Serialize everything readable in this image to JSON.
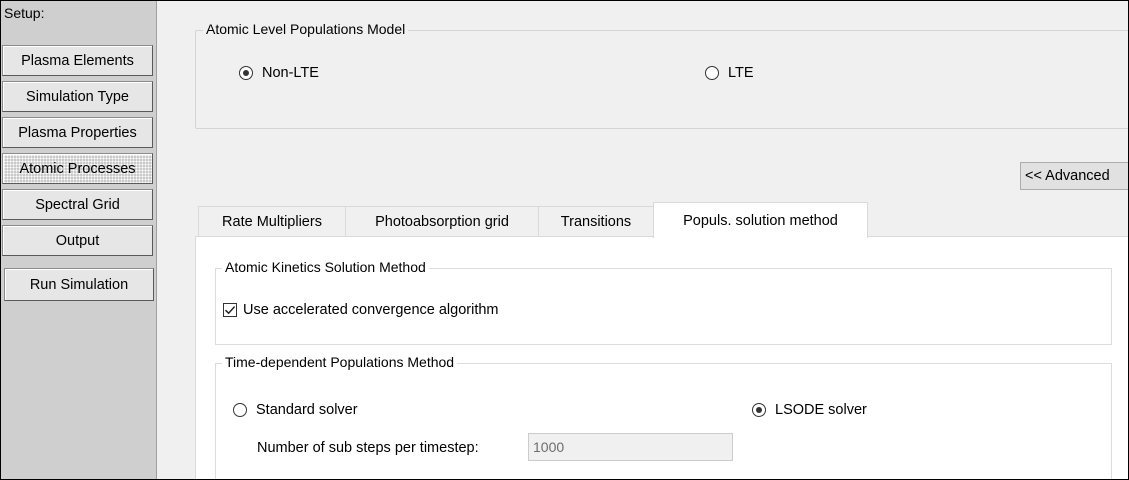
{
  "sidebar": {
    "title": "Setup:",
    "items": [
      {
        "label": "Plasma Elements"
      },
      {
        "label": "Simulation Type"
      },
      {
        "label": "Plasma Properties"
      },
      {
        "label": "Atomic Processes",
        "active": true
      },
      {
        "label": "Spectral Grid"
      },
      {
        "label": "Output"
      }
    ],
    "run_label": "Run Simulation"
  },
  "populations_model": {
    "title": "Atomic Level Populations Model",
    "options": [
      {
        "label": "Non-LTE",
        "selected": true
      },
      {
        "label": "LTE",
        "selected": false
      }
    ]
  },
  "advanced_button": "<< Advanced",
  "tabs": [
    {
      "label": "Rate Multipliers"
    },
    {
      "label": "Photoabsorption grid"
    },
    {
      "label": "Transitions"
    },
    {
      "label": "Populs. solution method",
      "active": true
    }
  ],
  "kinetics": {
    "title": "Atomic Kinetics Solution Method",
    "checkbox_label": "Use accelerated convergence algorithm",
    "checked": true
  },
  "time_dependent": {
    "title": "Time-dependent Populations Method",
    "options": [
      {
        "label": "Standard solver",
        "selected": false
      },
      {
        "label": "LSODE solver",
        "selected": true
      }
    ],
    "substeps_label": "Number of sub steps per timestep:",
    "substeps_value": "1000"
  }
}
